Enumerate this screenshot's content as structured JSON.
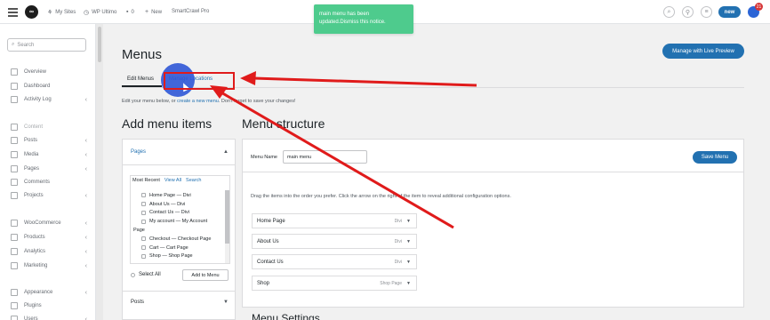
{
  "topbar": {
    "logo_text": "∞",
    "my_sites": "My Sites",
    "site_name": "WP Ultimo",
    "comments_count": "0",
    "new_label": "New",
    "theme_name": "SmartCrawl Pro",
    "new_button": "new",
    "notification_count": "21"
  },
  "notice": {
    "text": "main menu has been updated.Dismiss this notice."
  },
  "sidebar": {
    "search_placeholder": "Search",
    "items": [
      {
        "label": "Overview",
        "icon": "grid-icon",
        "chevron": ""
      },
      {
        "label": "Dashboard",
        "icon": "dashboard-icon",
        "chevron": ""
      },
      {
        "label": "Activity Log",
        "icon": "history-icon",
        "chevron": "‹"
      },
      {
        "label": "Content",
        "icon": "content-icon",
        "chevron": ""
      },
      {
        "label": "Posts",
        "icon": "pin-icon",
        "chevron": "‹"
      },
      {
        "label": "Media",
        "icon": "media-icon",
        "chevron": "‹"
      },
      {
        "label": "Pages",
        "icon": "pages-icon",
        "chevron": "‹"
      },
      {
        "label": "Comments",
        "icon": "comments-icon",
        "chevron": ""
      },
      {
        "label": "Projects",
        "icon": "projects-icon",
        "chevron": "‹"
      },
      {
        "label": "WooCommerce",
        "icon": "woo-icon",
        "chevron": "‹"
      },
      {
        "label": "Products",
        "icon": "products-icon",
        "chevron": "‹"
      },
      {
        "label": "Analytics",
        "icon": "analytics-icon",
        "chevron": "‹"
      },
      {
        "label": "Marketing",
        "icon": "marketing-icon",
        "chevron": "‹"
      },
      {
        "label": "Appearance",
        "icon": "appearance-icon",
        "chevron": "‹"
      },
      {
        "label": "Plugins",
        "icon": "plugins-icon",
        "chevron": ""
      },
      {
        "label": "Users",
        "icon": "users-icon",
        "chevron": "‹"
      }
    ]
  },
  "main": {
    "title": "Menus",
    "live_preview_button": "Manage with Live Preview",
    "tabs": [
      {
        "label": "Edit Menus"
      },
      {
        "label": "Manage Locations"
      }
    ],
    "info_prefix": "Edit your menu below, or",
    "info_link": "create a new menu",
    "info_suffix": ". Don't forget to save your changes!",
    "add_items_heading": "Add menu items",
    "structure_heading": "Menu structure",
    "settings_heading": "Menu Settings"
  },
  "add_items": {
    "pages_heading": "Pages",
    "pages_tabs": [
      "Most Recent",
      "View All",
      "Search"
    ],
    "pages_list": [
      {
        "label": "Home Page — Divi",
        "indent": true,
        "checkbox": true
      },
      {
        "label": "About Us — Divi",
        "indent": true,
        "checkbox": true
      },
      {
        "label": "Contact Us — Divi",
        "indent": true,
        "checkbox": true
      },
      {
        "label": "My account — My Account",
        "indent": true,
        "checkbox": true
      },
      {
        "label": "Page",
        "indent": false,
        "checkbox": false
      },
      {
        "label": "Checkout — Checkout Page",
        "indent": true,
        "checkbox": true
      },
      {
        "label": "Cart — Cart Page",
        "indent": true,
        "checkbox": true
      },
      {
        "label": "Shop — Shop Page",
        "indent": true,
        "checkbox": true
      }
    ],
    "select_all": "Select All",
    "add_to_menu": "Add to Menu",
    "posts_heading": "Posts"
  },
  "structure": {
    "menu_name_label": "Menu Name",
    "menu_name_value": "main menu",
    "save_button": "Save Menu",
    "drag_text": "Drag the items into the order you prefer. Click the arrow on the right of the item to reveal additional configuration options.",
    "items": [
      {
        "label": "Home Page",
        "type": "Divi"
      },
      {
        "label": "About Us",
        "type": "Divi"
      },
      {
        "label": "Contact Us",
        "type": "Divi"
      },
      {
        "label": "Shop",
        "type": "Shop Page"
      }
    ]
  },
  "colors": {
    "accent": "#2271b1",
    "notice": "#4ecb8d",
    "annotation": "#e01b1b",
    "click_marker": "#2f57d6"
  }
}
